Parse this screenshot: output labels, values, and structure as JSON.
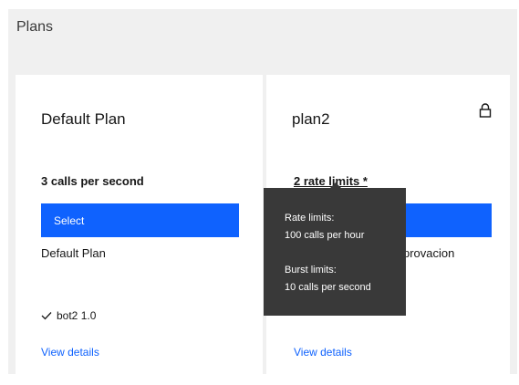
{
  "panel": {
    "title": "Plans"
  },
  "plans": [
    {
      "title": "Default Plan",
      "rate": "3 calls per second",
      "select_label": "Select",
      "description": "Default Plan",
      "api": "bot2 1.0",
      "view_details": "View details"
    },
    {
      "title": "plan2",
      "rate_link": "2 rate limits *",
      "select_label": "Select",
      "description": "provacion",
      "view_details": "View details",
      "locked": true
    }
  ],
  "tooltip": {
    "rate_heading": "Rate limits:",
    "rate_value": "100 calls per hour",
    "burst_heading": "Burst limits:",
    "burst_value": "10 calls per second"
  },
  "icons": {
    "lock": "lock-icon",
    "check": "checkmark-icon"
  },
  "colors": {
    "accent": "#0f62fe",
    "tooltip_bg": "#393939",
    "panel_bg": "#f0f0f0"
  }
}
